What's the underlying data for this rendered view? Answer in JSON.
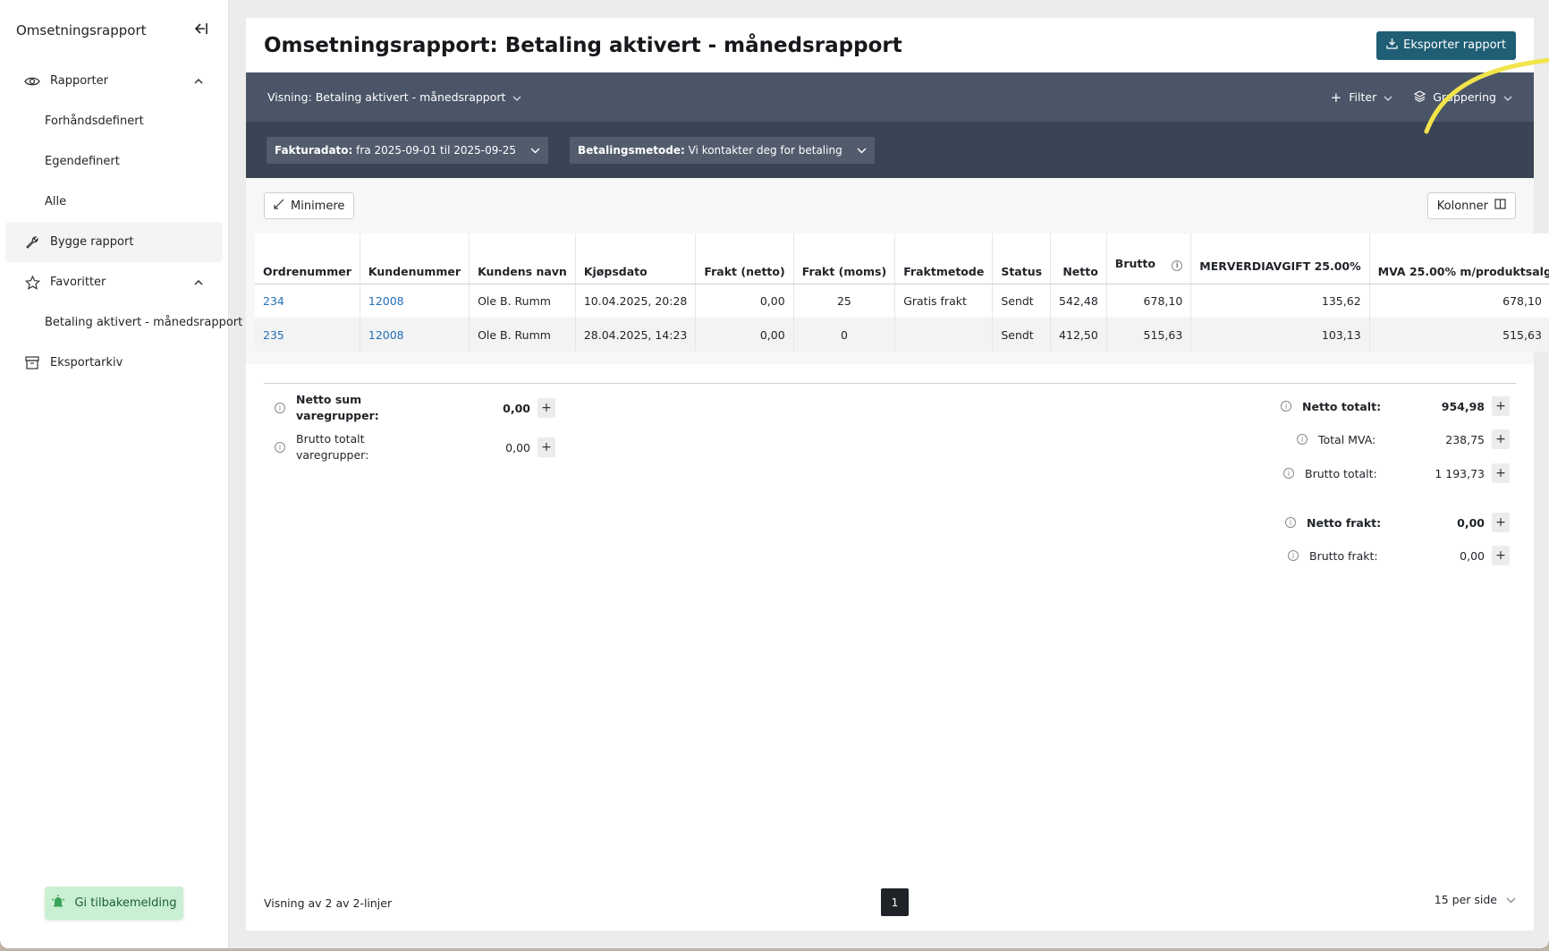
{
  "sidebar": {
    "title": "Omsetningsrapport",
    "items": [
      {
        "label": "Rapporter"
      },
      {
        "label": "Forhåndsdefinert"
      },
      {
        "label": "Egendefinert"
      },
      {
        "label": "Alle"
      },
      {
        "label": "Bygge rapport"
      },
      {
        "label": "Favoritter"
      },
      {
        "label": "Betaling aktivert - månedsrapport"
      },
      {
        "label": "Eksportarkiv"
      }
    ],
    "feedback_label": "Gi tilbakemelding"
  },
  "header": {
    "title": "Omsetningsrapport: Betaling aktivert - månedsrapport",
    "export_label": "Eksporter rapport"
  },
  "viewbar": {
    "view_label": "Visning: Betaling aktivert - månedsrapport",
    "filter_label": "Filter",
    "grouping_label": "Gruppering"
  },
  "filters": [
    {
      "key": "Fakturadato:",
      "value": "fra 2025-09-01 til 2025-09-25"
    },
    {
      "key": "Betalingsmetode:",
      "value": "Vi kontakter deg for betaling"
    }
  ],
  "toolbar": {
    "minimize_label": "Minimere",
    "columns_label": "Kolonner"
  },
  "table": {
    "headers": [
      "Ordrenummer",
      "Kundenummer",
      "Kundens navn",
      "Kjøpsdato",
      "Frakt (netto)",
      "Frakt (moms)",
      "Fraktmetode",
      "Status",
      "Netto",
      "Brutto",
      "MERVERDIAVGIFT 25.00%",
      "MVA 25.00% m/produktsalg"
    ],
    "rows": [
      [
        "234",
        "12008",
        "Ole B. Rumm",
        "10.04.2025, 20:28",
        "0,00",
        "25",
        "Gratis frakt",
        "Sendt",
        "542,48",
        "678,10",
        "135,62",
        "678,10"
      ],
      [
        "235",
        "12008",
        "Ole B. Rumm",
        "28.04.2025, 14:23",
        "0,00",
        "0",
        "",
        "Sendt",
        "412,50",
        "515,63",
        "103,13",
        "515,63"
      ]
    ]
  },
  "summary_left": [
    {
      "label": "Netto sum varegrupper:",
      "value": "0,00"
    },
    {
      "label": "Brutto totalt varegrupper:",
      "value": "0,00"
    }
  ],
  "summary_right": [
    {
      "label": "Netto totalt:",
      "value": "954,98"
    },
    {
      "label": "Total MVA:",
      "value": "238,75"
    },
    {
      "label": "Brutto totalt:",
      "value": "1 193,73"
    },
    {
      "label": "Netto frakt:",
      "value": "0,00"
    },
    {
      "label": "Brutto frakt:",
      "value": "0,00"
    }
  ],
  "footer": {
    "showing_label": "Visning av 2 av 2-linjer",
    "current_page": "1",
    "per_page_label": "15 per side"
  },
  "colors": {
    "export_button": "#1f5e74",
    "viewbar": "#4a5567",
    "filterbar": "#3a4455",
    "link": "#2270b8",
    "annotation_arrow": "#f2e44a"
  }
}
